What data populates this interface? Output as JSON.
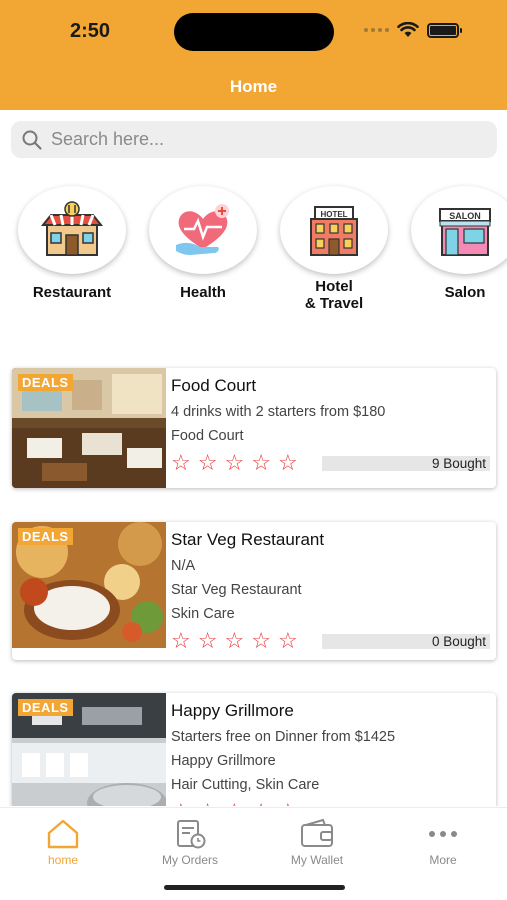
{
  "status_bar": {
    "time": "2:50"
  },
  "header": {
    "title": "Home"
  },
  "search": {
    "placeholder": "Search here..."
  },
  "categories": [
    {
      "label": "Restaurant",
      "icon": "restaurant-icon"
    },
    {
      "label": "Health",
      "icon": "health-icon"
    },
    {
      "label": "Hotel\n& Travel",
      "icon": "hotel-icon"
    },
    {
      "label": "Salon",
      "icon": "salon-icon"
    }
  ],
  "deals": [
    {
      "badge": "DEALS",
      "title": "Food Court",
      "lines": [
        "4 drinks with 2 starters from $180",
        "Food Court"
      ],
      "rating": 0,
      "bought": "9 Bought"
    },
    {
      "badge": "DEALS",
      "title": "Star Veg Restaurant",
      "lines": [
        "N/A",
        "Star Veg Restaurant",
        "Skin Care"
      ],
      "rating": 0,
      "bought": "0 Bought"
    },
    {
      "badge": "DEALS",
      "title": "Happy Grillmore",
      "lines": [
        "Starters free on Dinner from $1425",
        "Happy Grillmore",
        "Hair Cutting, Skin Care"
      ],
      "rating": 0,
      "bought": ""
    }
  ],
  "tabbar": {
    "items": [
      {
        "label": "home",
        "icon": "home-icon",
        "active": true
      },
      {
        "label": "My Orders",
        "icon": "orders-icon",
        "active": false
      },
      {
        "label": "My Wallet",
        "icon": "wallet-icon",
        "active": false
      },
      {
        "label": "More",
        "icon": "more-icon",
        "active": false
      }
    ]
  },
  "colors": {
    "accent": "#F2A634",
    "star": "#E8393A"
  }
}
